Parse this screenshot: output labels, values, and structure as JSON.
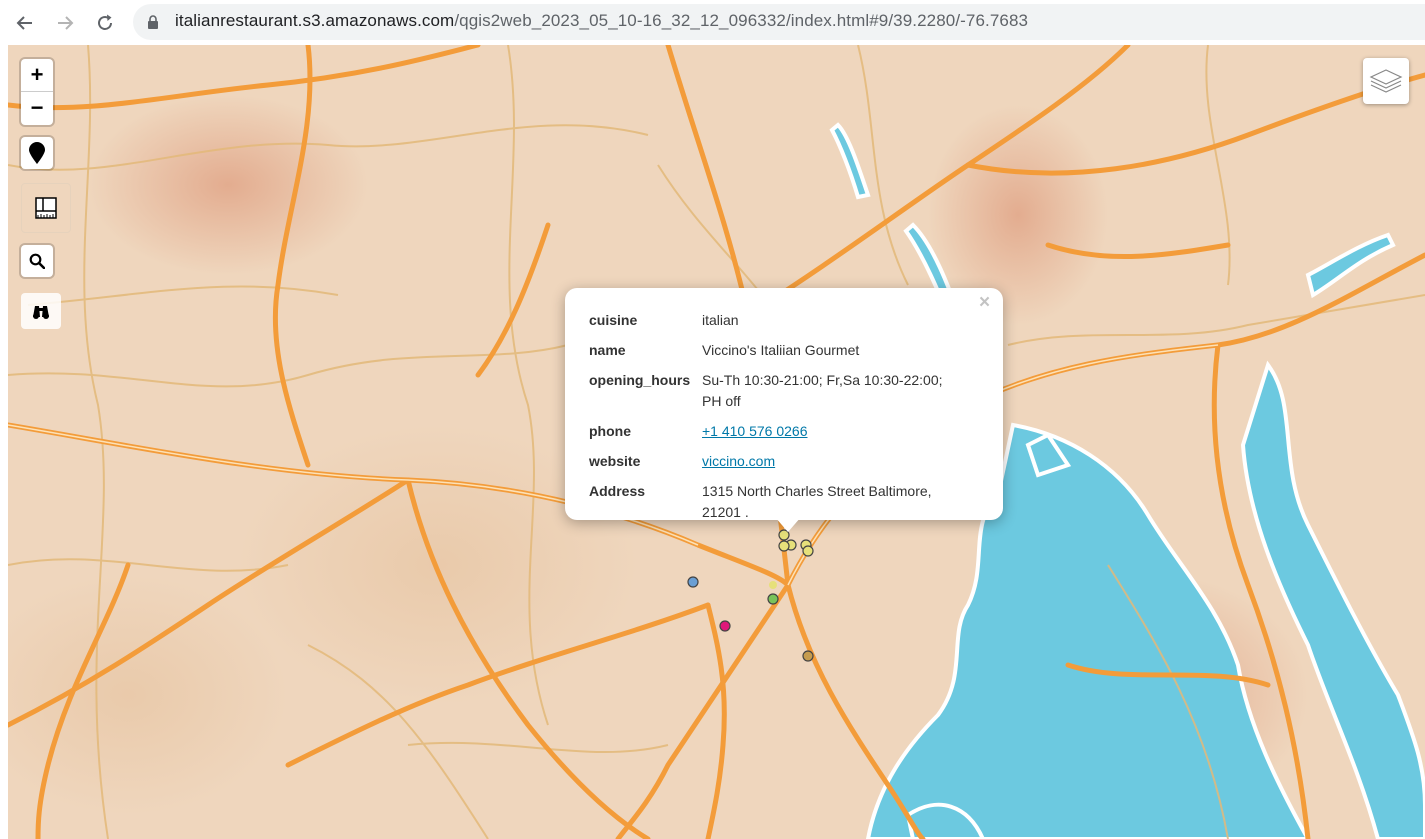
{
  "browser": {
    "back_icon": "arrow-left-icon",
    "forward_icon": "arrow-right-icon",
    "reload_icon": "reload-icon",
    "lock_icon": "lock-icon",
    "url_host": "italianrestaurant.s3.amazonaws.com",
    "url_path": "/qgis2web_2023_05_10-16_32_12_096332/index.html#9/39.2280/-76.7683"
  },
  "map": {
    "controls": {
      "zoom_in": "+",
      "zoom_out": "−",
      "locate_icon": "map-pin-icon",
      "measure_icon": "ruler-icon",
      "search_icon": "search-icon",
      "geocoder_icon": "binoculars-icon",
      "layers_icon": "layers-icon"
    },
    "colors": {
      "land": "#efd6bd",
      "water": "#6cc9e0",
      "road": "#f39c3a"
    },
    "markers": [
      {
        "color": "#e6e07a"
      },
      {
        "color": "#e6e07a"
      },
      {
        "color": "#e6e07a"
      },
      {
        "color": "#e6e07a"
      },
      {
        "color": "#e6e07a"
      },
      {
        "color": "#e6e07a"
      },
      {
        "color": "#6a9fd4"
      },
      {
        "color": "#79c35a"
      },
      {
        "color": "#e0187a"
      },
      {
        "color": "#c59c4f"
      }
    ]
  },
  "popup": {
    "close_label": "×",
    "rows": [
      {
        "key": "cuisine",
        "value": "italian"
      },
      {
        "key": "name",
        "value": "Viccino's Italiian Gourmet"
      },
      {
        "key": "opening_hours",
        "value": "Su-Th 10:30-21:00; Fr,Sa 10:30-22:00; PH off"
      },
      {
        "key": "phone",
        "value": "+1 410 576 0266"
      },
      {
        "key": "website",
        "value": "viccino.com"
      },
      {
        "key": "Address",
        "value": "1315 North Charles Street Baltimore, 21201 ."
      }
    ]
  }
}
